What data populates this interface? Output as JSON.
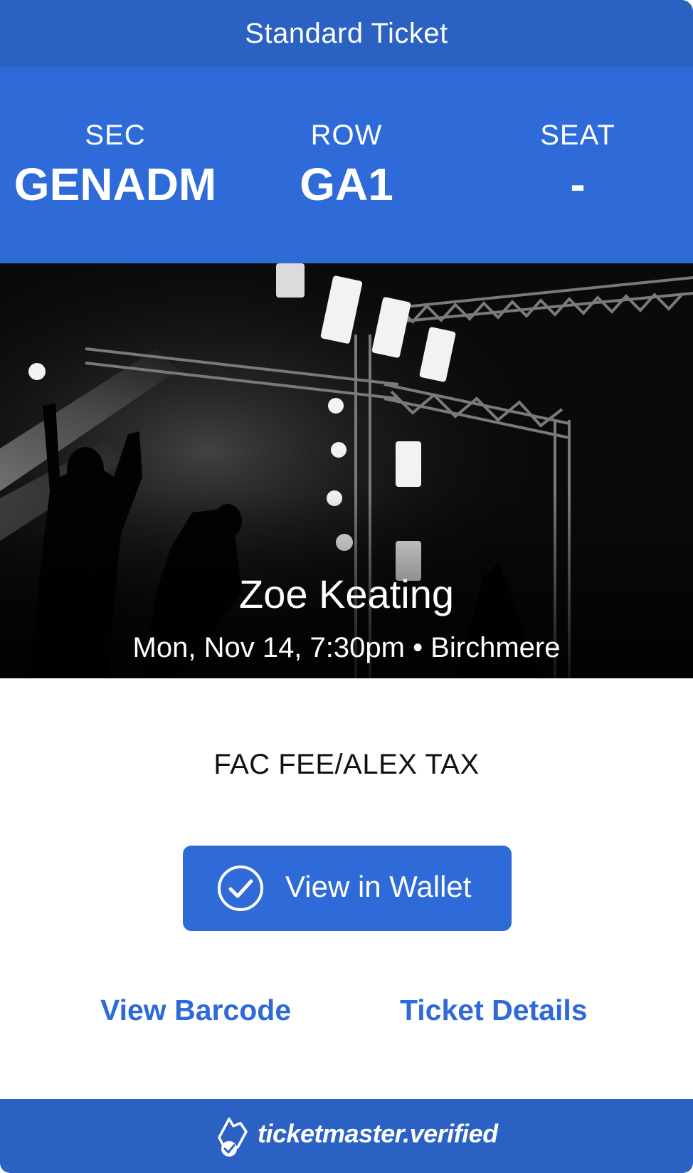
{
  "ticket_type": "Standard Ticket",
  "seat_info": {
    "section": {
      "label": "SEC",
      "value": "GENADM"
    },
    "row": {
      "label": "ROW",
      "value": "GA1"
    },
    "seat": {
      "label": "SEAT",
      "value": "-"
    }
  },
  "event": {
    "name": "Zoe Keating",
    "meta": "Mon, Nov 14, 7:30pm • Birchmere",
    "image": "concert-stage-photo"
  },
  "fee_description": "FAC FEE/ALEX TAX",
  "actions": {
    "wallet_label": "View in Wallet",
    "wallet_icon": "checkmark-circle-icon",
    "barcode_label": "View Barcode",
    "details_label": "Ticket Details"
  },
  "footer": {
    "brand": "ticketmaster.verified",
    "icon": "ticketmaster-verified-icon"
  },
  "colors": {
    "primary": "#2e6ad8",
    "header": "#2a61c3",
    "text": "#111111",
    "background": "#ffffff"
  }
}
